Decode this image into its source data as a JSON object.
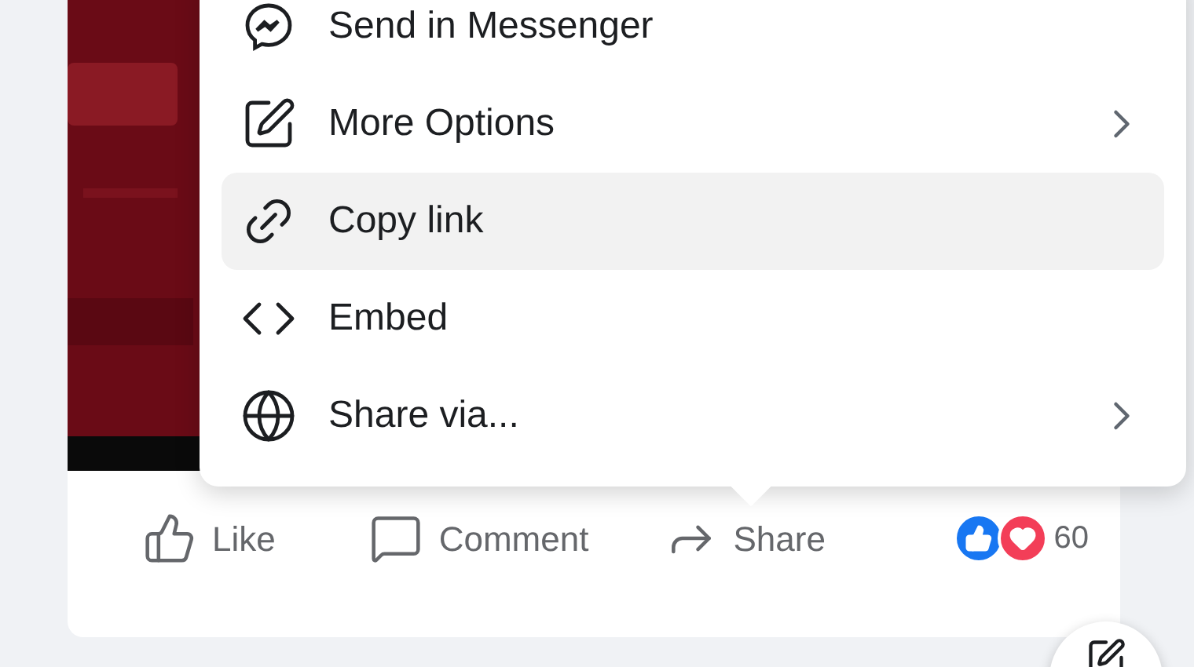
{
  "menu": {
    "items": [
      {
        "kind": "messenger",
        "label": "Send in Messenger",
        "submenu": false,
        "selected": false
      },
      {
        "kind": "edit",
        "label": "More Options",
        "submenu": true,
        "selected": false
      },
      {
        "kind": "link",
        "label": "Copy link",
        "submenu": false,
        "selected": true
      },
      {
        "kind": "embed",
        "label": "Embed",
        "submenu": false,
        "selected": false
      },
      {
        "kind": "globe",
        "label": "Share via...",
        "submenu": true,
        "selected": false
      }
    ]
  },
  "post": {
    "actions": [
      {
        "kind": "like",
        "label": "Like"
      },
      {
        "kind": "comment",
        "label": "Comment"
      },
      {
        "kind": "share",
        "label": "Share"
      }
    ],
    "reaction_count": "60"
  }
}
